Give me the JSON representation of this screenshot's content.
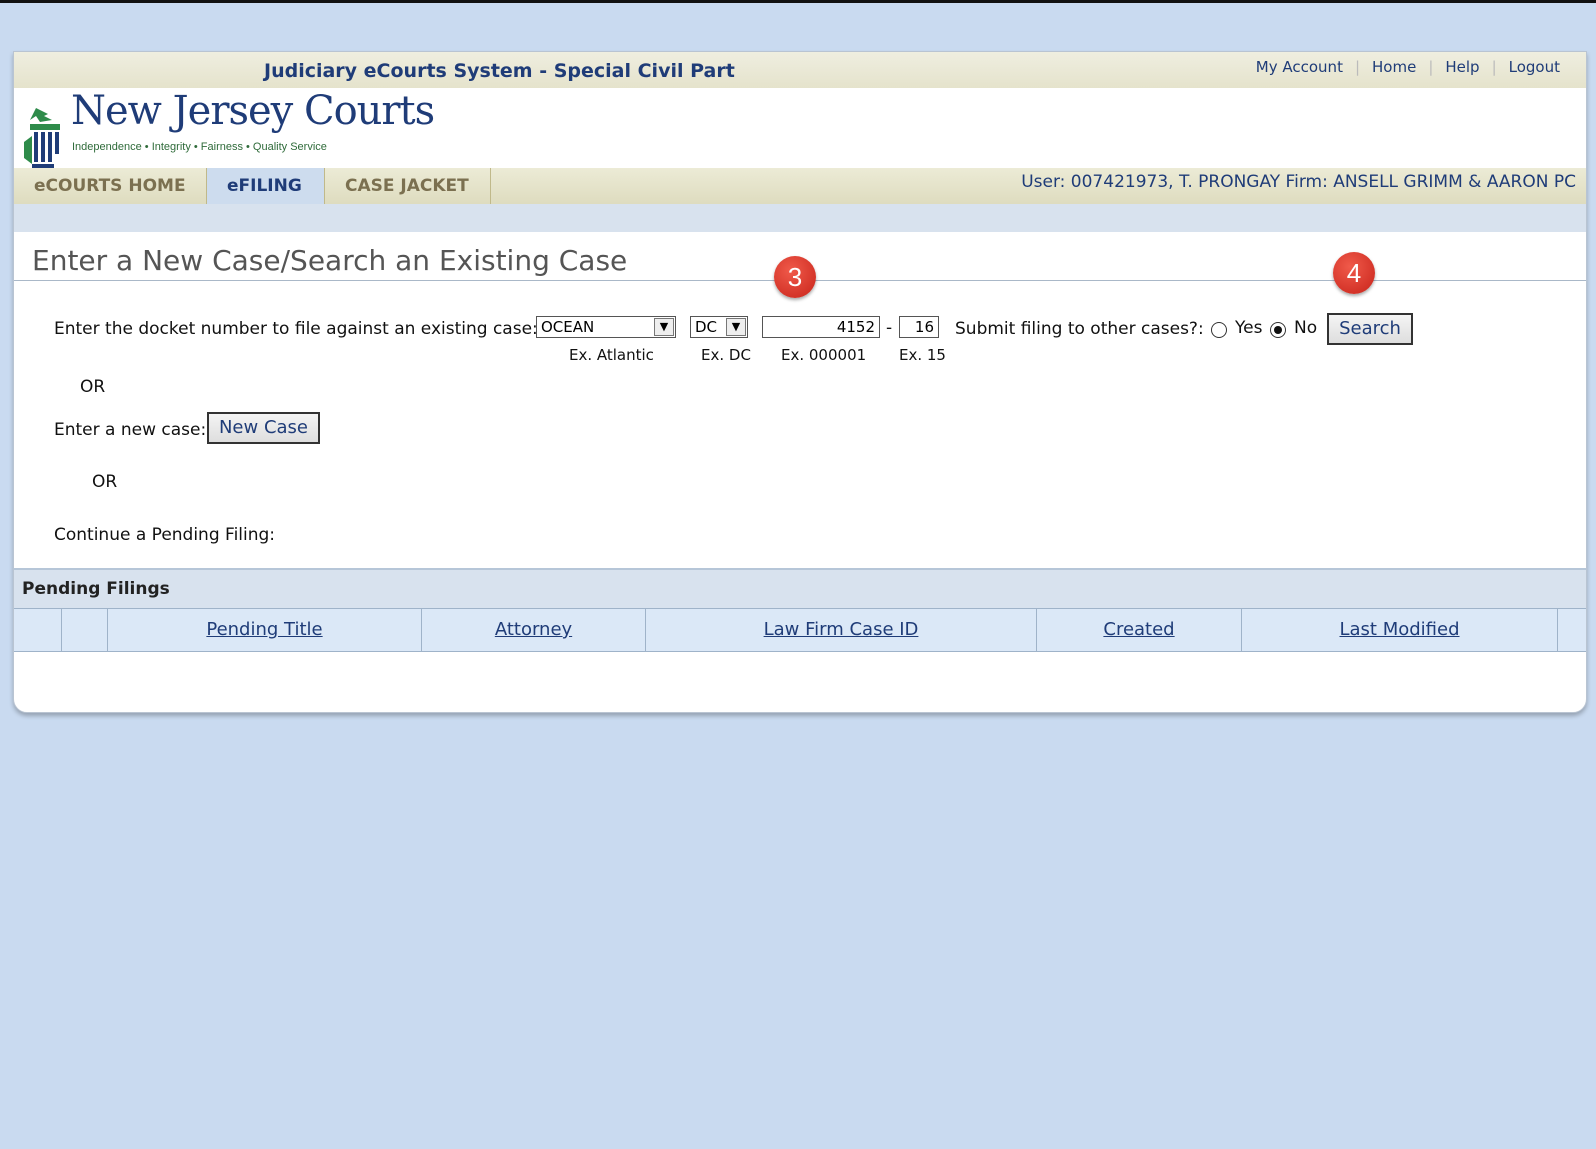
{
  "header": {
    "system_title": "Judiciary eCourts System - Special Civil Part",
    "links": [
      "My Account",
      "Home",
      "Help",
      "Logout"
    ],
    "logo_text": "New Jersey Courts",
    "logo_tagline": "Independence • Integrity • Fairness • Quality Service"
  },
  "nav": {
    "tabs": [
      "eCOURTS HOME",
      "eFILING",
      "CASE JACKET"
    ],
    "active_tab": "eFILING",
    "user_info": "User: 007421973, T. PRONGAY  Firm: ANSELL GRIMM & AARON PC"
  },
  "main": {
    "page_title": "Enter a New Case/Search an Existing Case",
    "docket_label": "Enter the docket number to file against an existing case:",
    "county_value": "OCEAN",
    "county_hint": "Ex. Atlantic",
    "type_value": "DC",
    "type_hint": "Ex. DC",
    "number_value": "4152",
    "number_hint": "Ex. 000001",
    "dash": "-",
    "year_value": "16",
    "year_hint": "Ex. 15",
    "submit_other_label": "Submit filing to other cases?:",
    "yes_label": "Yes",
    "no_label": "No",
    "search_label": "Search",
    "or1": "OR",
    "new_case_label": "Enter a new case:",
    "new_case_button": "New Case",
    "or2": "OR",
    "continue_label": "Continue a Pending Filing:"
  },
  "annotations": {
    "step3": "3",
    "step4": "4",
    "badge_color": "#d9302a"
  },
  "pending": {
    "header": "Pending Filings",
    "columns": [
      "",
      "",
      "Pending Title",
      "Attorney",
      "Law Firm Case ID",
      "Created",
      "Last Modified"
    ]
  }
}
